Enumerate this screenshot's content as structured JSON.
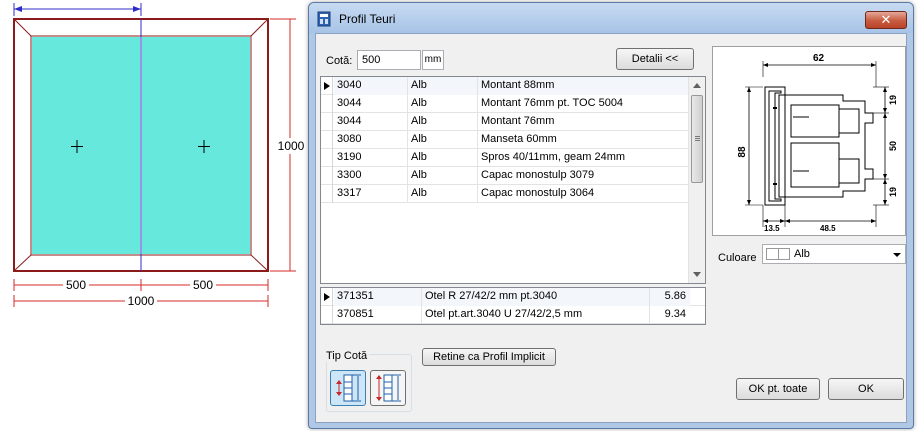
{
  "drawing": {
    "dim_top_width": "",
    "dim_height": "1000",
    "dim_left_panel": "500",
    "dim_right_panel": "500",
    "dim_total_width": "1000",
    "glass_color": "#66e8dd",
    "frame_color": "#8b1a1a",
    "dim_color": "#d62828",
    "mullion_color": "#2d2dc8"
  },
  "dialog": {
    "title": "Profil Teuri",
    "close_symbol": "✕",
    "cota": {
      "label": "Cotă:",
      "value": "500",
      "unit": "mm"
    },
    "detalii_button": "Detalii <<",
    "profiles": [
      {
        "code": "3040",
        "color": "Alb",
        "desc": "Montant 88mm",
        "current": true
      },
      {
        "code": "3044",
        "color": "Alb",
        "desc": "Montant 76mm pt. TOC 5004",
        "current": false
      },
      {
        "code": "3044",
        "color": "Alb",
        "desc": "Montant 76mm",
        "current": false
      },
      {
        "code": "3080",
        "color": "Alb",
        "desc": "Manseta 60mm",
        "current": false
      },
      {
        "code": "3190",
        "color": "Alb",
        "desc": "Spros 40/11mm, geam 24mm",
        "current": false
      },
      {
        "code": "3300",
        "color": "Alb",
        "desc": "Capac monostulp 3079",
        "current": false
      },
      {
        "code": "3317",
        "color": "Alb",
        "desc": "Capac monostulp 3064",
        "current": false
      }
    ],
    "reinforcements": [
      {
        "code": "371351",
        "desc": "Otel R 27/42/2 mm pt.3040",
        "value": "5.86",
        "current": true
      },
      {
        "code": "370851",
        "desc": "Otel pt.art.3040 U 27/42/2,5 mm",
        "value": "9.34",
        "current": false
      }
    ],
    "tip_cota_label": "Tip Cotă",
    "retine_button": "Retine ca Profil Implicit",
    "preview": {
      "dim_width": "62",
      "dim_height": "88",
      "dim_top": "19",
      "dim_mid": "50",
      "dim_bottom": "19",
      "dim_left": "13.5",
      "dim_right": "48.5"
    },
    "culoare": {
      "label": "Culoare",
      "value": "Alb"
    },
    "ok_all_button": "OK pt. toate",
    "ok_button": "OK"
  }
}
